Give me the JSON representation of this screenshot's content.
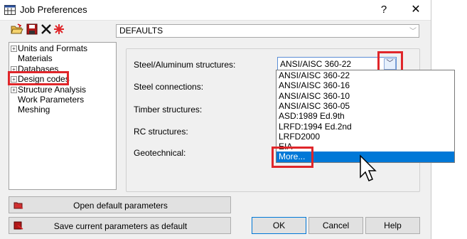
{
  "window": {
    "title": "Job Preferences",
    "help_glyph": "?",
    "close_glyph": "✕"
  },
  "toolbar": {
    "icons": [
      "open-folder-icon",
      "save-icon",
      "delete-x-icon",
      "reset-star-icon"
    ]
  },
  "defaults_combo": {
    "value": "DEFAULTS"
  },
  "tree": {
    "items": [
      {
        "label": "Units and Formats",
        "expandable": true
      },
      {
        "label": "Materials",
        "expandable": false
      },
      {
        "label": "Databases",
        "expandable": true
      },
      {
        "label": "Design codes",
        "expandable": true,
        "highlighted": true
      },
      {
        "label": "Structure Analysis",
        "expandable": true
      },
      {
        "label": "Work Parameters",
        "expandable": false
      },
      {
        "label": "Meshing",
        "expandable": false
      }
    ]
  },
  "form": {
    "labels": {
      "steel": "Steel/Aluminum structures:",
      "steel_connections": "Steel connections:",
      "timber": "Timber structures:",
      "rc": "RC structures:",
      "geotechnical": "Geotechnical:"
    },
    "steel_value": "ANSI/AISC 360-22",
    "dropdown_options": [
      "ANSI/AISC 360-22",
      "ANSI/AISC 360-16",
      "ANSI/AISC 360-10",
      "ANSI/AISC 360-05",
      "ASD:1989 Ed.9th",
      "LRFD:1994 Ed.2nd",
      "LRFD2000",
      "EIA",
      "More..."
    ],
    "selected_option": "More..."
  },
  "buttons": {
    "open_defaults": "Open default parameters",
    "save_defaults": "Save current parameters as default",
    "ok": "OK",
    "cancel": "Cancel",
    "help": "Help"
  },
  "colors": {
    "highlight": "#e0262a",
    "selection": "#0078d7"
  }
}
